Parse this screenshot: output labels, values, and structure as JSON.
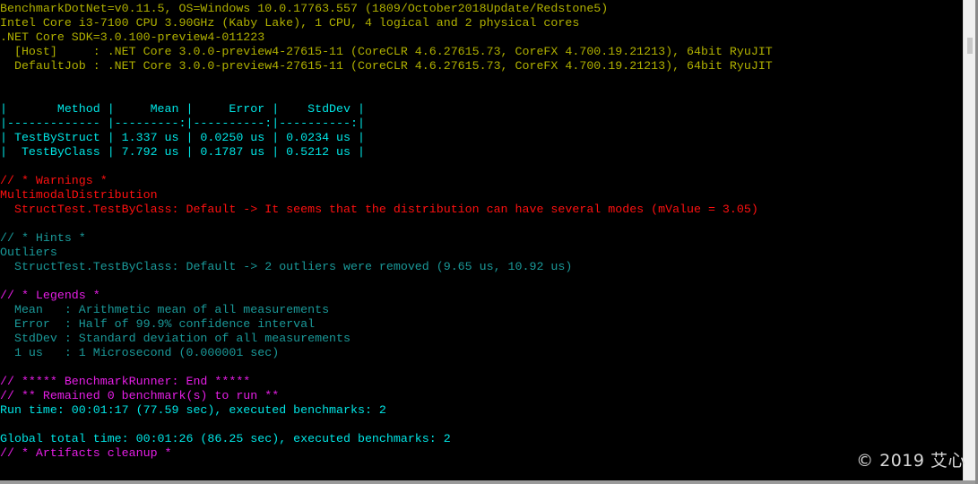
{
  "window": {
    "type": "console",
    "scrollbar": {
      "thumb_position": "near-top"
    }
  },
  "colors": {
    "env_text": "#b0b000",
    "table_text": "#00e5e5",
    "info_text": "#1a9999",
    "warning_text": "#ff1010",
    "section_header": "#e61ee6",
    "background": "#000000"
  },
  "environment": {
    "line1": "BenchmarkDotNet=v0.11.5, OS=Windows 10.0.17763.557 (1809/October2018Update/Redstone5)",
    "line2": "Intel Core i3-7100 CPU 3.90GHz (Kaby Lake), 1 CPU, 4 logical and 2 physical cores",
    "line3": ".NET Core SDK=3.0.100-preview4-011223",
    "line4": "  [Host]     : .NET Core 3.0.0-preview4-27615-11 (CoreCLR 4.6.27615.73, CoreFX 4.700.19.21213), 64bit RyuJIT",
    "line5": "  DefaultJob : .NET Core 3.0.0-preview4-27615-11 (CoreCLR 4.6.27615.73, CoreFX 4.700.19.21213), 64bit RyuJIT"
  },
  "results_table": {
    "header": "|       Method |     Mean |     Error |    StdDev |",
    "separator": "|------------- |---------:|----------:|----------:|",
    "columns": [
      "Method",
      "Mean",
      "Error",
      "StdDev"
    ],
    "rows": [
      {
        "method": "TestByStruct",
        "mean": "1.337 us",
        "error": "0.0250 us",
        "stddev": "0.0234 us",
        "text": "| TestByStruct | 1.337 us | 0.0250 us | 0.0234 us |"
      },
      {
        "method": "TestByClass",
        "mean": "7.792 us",
        "error": "0.1787 us",
        "stddev": "0.5212 us",
        "text": "|  TestByClass | 7.792 us | 0.1787 us | 0.5212 us |"
      }
    ]
  },
  "warnings": {
    "header": "// * Warnings *",
    "category": "MultimodalDistribution",
    "message": "  StructTest.TestByClass: Default -> It seems that the distribution can have several modes (mValue = 3.05)"
  },
  "hints": {
    "header": "// * Hints *",
    "category": "Outliers",
    "message": "  StructTest.TestByClass: Default -> 2 outliers were removed (9.65 us, 10.92 us)"
  },
  "legends": {
    "header": "// * Legends *",
    "items": [
      "  Mean   : Arithmetic mean of all measurements",
      "  Error  : Half of 99.9% confidence interval",
      "  StdDev : Standard deviation of all measurements",
      "  1 us   : 1 Microsecond (0.000001 sec)"
    ]
  },
  "summary": {
    "runner_end": "// ***** BenchmarkRunner: End *****",
    "remained": "// ** Remained 0 benchmark(s) to run **",
    "run_time": "Run time: 00:01:17 (77.59 sec), executed benchmarks: 2",
    "global_time": "Global total time: 00:01:26 (86.25 sec), executed benchmarks: 2",
    "artifacts": "// * Artifacts cleanup *"
  },
  "watermark": "© 2019 艾心"
}
